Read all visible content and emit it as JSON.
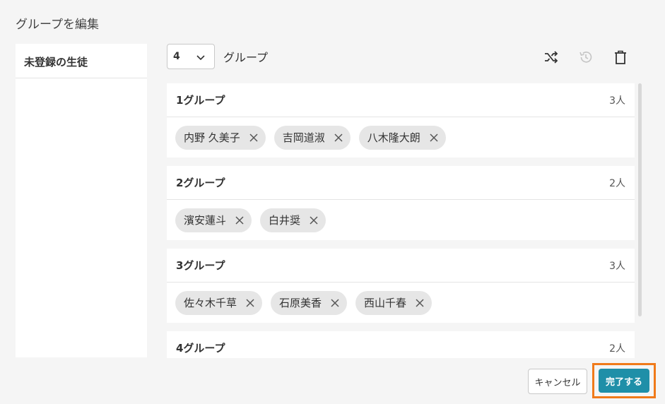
{
  "dialog": {
    "title": "グループを編集"
  },
  "unassigned": {
    "header": "未登録の生徒"
  },
  "toolbar": {
    "group_count": "4",
    "group_label": "グループ",
    "icons": [
      "shuffle-icon",
      "history-icon",
      "trash-icon"
    ]
  },
  "groups": [
    {
      "name": "1グループ",
      "count": "3人",
      "members": [
        "内野 久美子",
        "吉岡道淑",
        "八木隆大朗"
      ]
    },
    {
      "name": "2グループ",
      "count": "2人",
      "members": [
        "濱安蓮斗",
        "白井奨"
      ]
    },
    {
      "name": "3グループ",
      "count": "3人",
      "members": [
        "佐々木千草",
        "石原美香",
        "西山千春"
      ]
    },
    {
      "name": "4グループ",
      "count": "2人",
      "members": []
    }
  ],
  "footer": {
    "cancel_label": "キャンセル",
    "done_label": "完了する"
  },
  "colors": {
    "primary": "#1f8fa8",
    "highlight": "#f07a1a",
    "chip": "#e6e6e6"
  }
}
